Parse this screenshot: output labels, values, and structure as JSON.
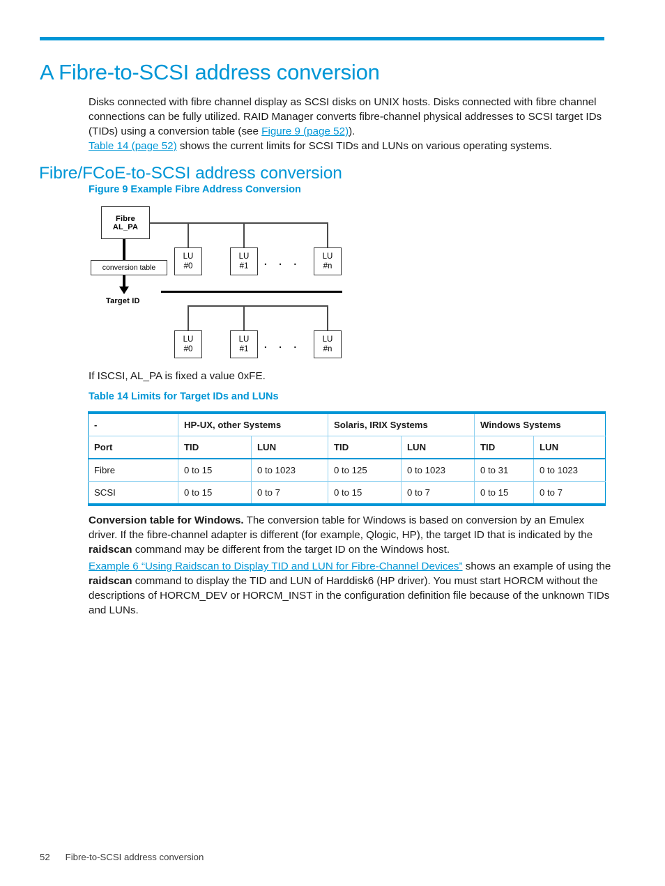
{
  "colors": {
    "accent": "#0096d6",
    "table_border_light": "#8ed1f0",
    "text": "#1a1a1a",
    "diagram_stroke": "#333333"
  },
  "chapter": {
    "title": "A Fibre-to-SCSI address conversion"
  },
  "intro": {
    "line1": "Disks connected with fibre channel display as SCSI disks on UNIX hosts. Disks connected with",
    "line2": "fibre channel connections can be fully utilized. RAID Manager converts fibre-channel physical",
    "line3_pre": "addresses to SCSI target IDs (TIDs) using a conversion table (see ",
    "link_figure9": "Figure 9 (page 52)",
    "line3_post": ").",
    "link_table14": "Table 14 (page 52)",
    "line4_post": " shows the current limits for SCSI TIDs and LUNs on various operating systems."
  },
  "section": {
    "heading": "Fibre/FCoE-to-SCSI address conversion"
  },
  "figure": {
    "caption": "Figure 9 Example Fibre Address Conversion",
    "fibre_box_line1": "Fibre",
    "fibre_box_line2": "AL_PA",
    "conversion_table_label": "conversion table",
    "target_id_label": "Target ID",
    "ellipsis": ". . .",
    "upper_lus": [
      {
        "line1": "LU",
        "line2": "#0"
      },
      {
        "line1": "LU",
        "line2": "#1"
      },
      {
        "line1": "LU",
        "line2": "#n"
      }
    ],
    "lower_lus": [
      {
        "line1": "LU",
        "line2": "#0"
      },
      {
        "line1": "LU",
        "line2": "#1"
      },
      {
        "line1": "LU",
        "line2": "#n"
      }
    ]
  },
  "iscsi_note": "If ISCSI, AL_PA is fixed a value 0xFE.",
  "table": {
    "caption": "Table 14 Limits for Target IDs and LUNs",
    "group_headers": [
      "-",
      "HP-UX, other Systems",
      "Solaris, IRIX Systems",
      "Windows Systems"
    ],
    "sub_headers": [
      "Port",
      "TID",
      "LUN",
      "TID",
      "LUN",
      "TID",
      "LUN"
    ],
    "rows": [
      [
        "Fibre",
        "0 to 15",
        "0 to 1023",
        "0 to 125",
        "0 to 1023",
        "0 to 31",
        "0 to 1023"
      ],
      [
        "SCSI",
        "0 to 15",
        "0 to 7",
        "0 to 15",
        "0 to 7",
        "0 to 15",
        "0 to 7"
      ]
    ]
  },
  "conversion_paragraph": {
    "lead": "Conversion table for Windows.",
    "part1": " The conversion table for Windows is based on conversion by an Emulex driver. If the fibre-channel adapter is different (for example, Qlogic, HP), the target ID that is indicated by the ",
    "bold_raidscan": "raidscan",
    "part2": " command may be different from the target ID on the Windows host."
  },
  "example_paragraph": {
    "link": "Example 6 “Using Raidscan to Display TID and LUN for Fibre-Channel Devices”",
    "part1": " shows an example of using the ",
    "bold_raidscan": "raidscan",
    "part2": " command to display the TID and LUN of Harddisk6 (HP driver). You must start HORCM without the descriptions of HORCM_DEV or HORCM_INST in the configuration definition file because of the unknown TIDs and LUNs."
  },
  "footer": {
    "page_number": "52",
    "chapter_label": "Fibre-to-SCSI address conversion"
  }
}
